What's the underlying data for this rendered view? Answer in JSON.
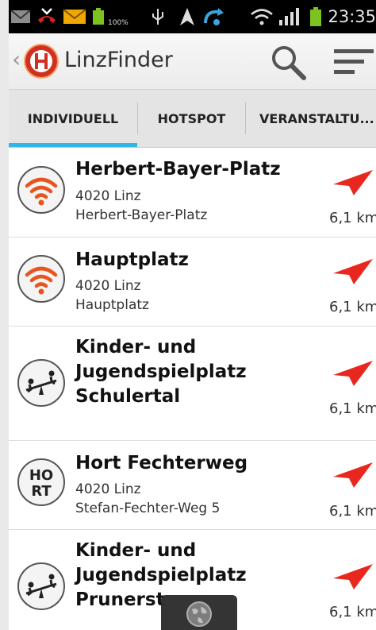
{
  "status_bar": {
    "time": "23:35",
    "battery_label": "100%"
  },
  "header": {
    "app_title": "LinzFinder"
  },
  "tabs": [
    {
      "label": "INDIVIDUELL",
      "selected": true
    },
    {
      "label": "HOTSPOT",
      "selected": false
    },
    {
      "label": "VERANSTALTU...",
      "selected": false
    }
  ],
  "list": [
    {
      "title": "Herbert-Bayer-Platz",
      "line1": "4020 Linz",
      "line2": "Herbert-Bayer-Platz",
      "distance": "6,1 km",
      "icon": "wifi-icon"
    },
    {
      "title": "Hauptplatz",
      "line1": "4020 Linz",
      "line2": "Hauptplatz",
      "distance": "6,1 km",
      "icon": "wifi-icon"
    },
    {
      "title": "Kinder- und",
      "title2": "Jugendspielplatz",
      "title3": "Schulertal",
      "distance": "6,1 km",
      "icon": "playground-icon"
    },
    {
      "title": "Hort Fechterweg",
      "line1": "4020 Linz",
      "line2": "Stefan-Fechter-Weg 5",
      "distance": "6,1 km",
      "icon": "hort-icon",
      "icon_text1": "HO",
      "icon_text2": "RT"
    },
    {
      "title": "Kinder- und",
      "title2": "Jugendspielplatz",
      "title3": "Prunerst",
      "distance": "6,1 km",
      "icon": "playground-icon"
    }
  ],
  "colors": {
    "accent": "#33b5e5",
    "arrow": "#e8281e",
    "wifi": "#e8541e"
  }
}
